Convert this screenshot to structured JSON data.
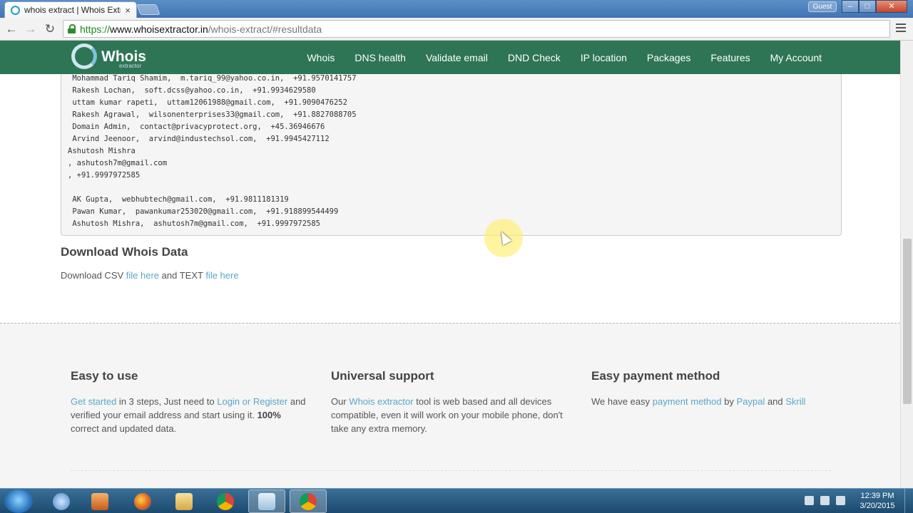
{
  "browser": {
    "tab_title": "whois extract | Whois Extr",
    "tab_close": "×",
    "guest_label": "Guest",
    "url_scheme": "https://",
    "url_host": "www.whoisextractor.in",
    "url_path": "/whois-extract/#resultdata"
  },
  "site": {
    "logo_text": "Whois",
    "logo_sub": "extractor",
    "nav": [
      "Whois",
      "DNS health",
      "Validate email",
      "DND Check",
      "IP location",
      "Packages",
      "Features",
      "My Account"
    ]
  },
  "results": [
    " Mohammad Tariq Shamim,  m.tariq_99@yahoo.co.in,  +91.9570141757",
    " Rakesh Lochan,  soft.dcss@yahoo.co.in,  +91.9934629580",
    " uttam kumar rapeti,  uttam12061988@gmail.com,  +91.9090476252",
    " Rakesh Agrawal,  wilsonenterprises33@gmail.com,  +91.8827088705",
    " Domain Admin,  contact@privacyprotect.org,  +45.36946676",
    " Arvind Jeenoor,  arvind@industechsol.com,  +91.9945427112",
    "Ashutosh Mishra",
    ", ashutosh7m@gmail.com",
    ", +91.9997972585",
    "",
    " AK Gupta,  webhubtech@gmail.com,  +91.9811181319",
    " Pawan Kumar,  pawankumar253020@gmail.com,  +91.918899544499",
    " Ashutosh Mishra,  ashutosh7m@gmail.com,  +91.9997972585"
  ],
  "download": {
    "title": "Download Whois Data",
    "text_before": "Download CSV ",
    "csv_link": "file here",
    "text_middle": " and TEXT ",
    "text_link": "file here"
  },
  "features": {
    "easy": {
      "title": "Easy to use",
      "link1": "Get started",
      "text1": " in 3 steps, Just need to ",
      "link2": "Login or Register",
      "text2": " and verified your email address and start using it. ",
      "bold": "100%",
      "text3": " correct and updated data."
    },
    "universal": {
      "title": "Universal support",
      "text1": "Our ",
      "link": "Whois extractor",
      "text2": " tool is web based and all devices compatible, even it will work on your mobile phone, don't take any extra memory."
    },
    "payment": {
      "title": "Easy payment method",
      "text1": "We have easy ",
      "link1": "payment method",
      "text2": " by ",
      "link2": "Paypal",
      "text3": " and ",
      "link3": "Skrill"
    }
  },
  "taskbar": {
    "time": "12:39 PM",
    "date": "3/20/2015"
  },
  "colors": {
    "site_nav": "#2e7555",
    "link": "#5aa6cc"
  }
}
